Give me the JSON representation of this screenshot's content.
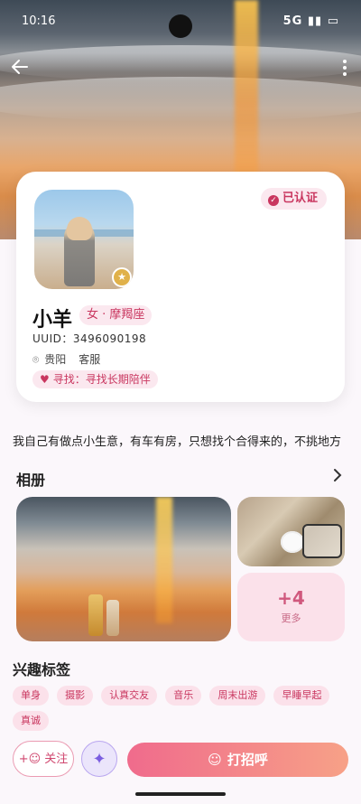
{
  "status": {
    "time": "10:16",
    "right": "5G ▮▮ ▭"
  },
  "profile": {
    "verified": "已认证",
    "name": "小羊",
    "gender_sign": "女 · 摩羯座",
    "uuid": "UUID：3496090198",
    "location": "贵阳",
    "job": "客服",
    "seeking": "寻找：寻找长期陪伴"
  },
  "bio": "我自己有做点小生意，有车有房，只想找个合得来的，不挑地方",
  "album": {
    "title": "相册",
    "more_count": "+4",
    "more_label": "更多"
  },
  "interests": {
    "title": "兴趣标签",
    "tags": [
      "单身",
      "摄影",
      "认真交友",
      "音乐",
      "周末出游",
      "早睡早起",
      "真诚"
    ]
  },
  "actions": {
    "follow": "关注",
    "greet": "打招呼"
  },
  "colors": {
    "accent": "#c9365f",
    "greet_start": "#f06b8c",
    "greet_end": "#f7a187"
  }
}
